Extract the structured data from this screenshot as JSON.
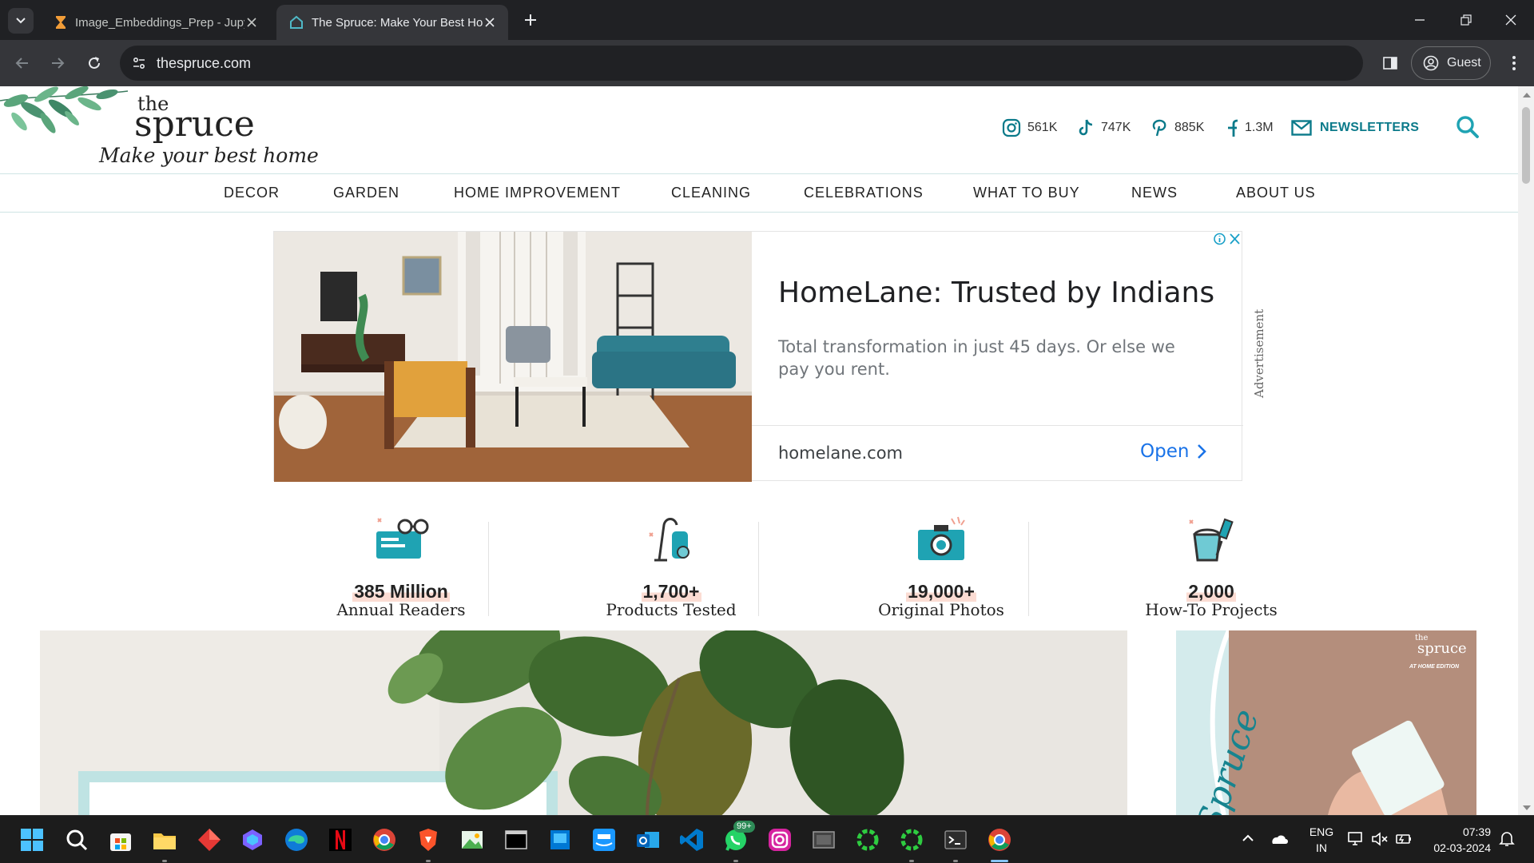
{
  "browser": {
    "tabs": [
      {
        "title": "Image_Embeddings_Prep - Jupy",
        "icon": "hourglass-icon",
        "active": false
      },
      {
        "title": "The Spruce: Make Your Best Ho",
        "icon": "spruce-favicon",
        "active": true
      }
    ],
    "url": "thespruce.com",
    "profile_label": "Guest"
  },
  "site": {
    "logo": {
      "the": "the",
      "name": "spruce",
      "tagline": "Make your best home"
    },
    "social": [
      {
        "icon": "instagram-icon",
        "count": "561K"
      },
      {
        "icon": "tiktok-icon",
        "count": "747K"
      },
      {
        "icon": "pinterest-icon",
        "count": "885K"
      },
      {
        "icon": "facebook-icon",
        "count": "1.3M"
      }
    ],
    "newsletters_label": "NEWSLETTERS",
    "accent_color": "#0b7a8a",
    "nav": [
      "DECOR",
      "GARDEN",
      "HOME IMPROVEMENT",
      "CLEANING",
      "CELEBRATIONS",
      "WHAT TO BUY",
      "NEWS",
      "ABOUT US"
    ]
  },
  "ad": {
    "title": "HomeLane: Trusted by Indians",
    "description": "Total transformation in just 45 days. Or else we pay you rent.",
    "domain": "homelane.com",
    "cta": "Open",
    "side_label": "Advertisement"
  },
  "stats": [
    {
      "value": "385 Million",
      "label": "Annual Readers",
      "icon": "glasses-laptop-icon"
    },
    {
      "value": "1,700+",
      "label": "Products Tested",
      "icon": "vacuum-icon"
    },
    {
      "value": "19,000+",
      "label": "Original Photos",
      "icon": "camera-icon"
    },
    {
      "value": "2,000",
      "label": "How-To Projects",
      "icon": "paint-bucket-icon"
    }
  ],
  "promo": {
    "brand_the": "the",
    "brand_name": "spruce",
    "edition": "AT HOME EDITION",
    "script": "Spruce"
  },
  "taskbar": {
    "apps": [
      "start-icon",
      "search-icon",
      "store-icon",
      "file-explorer-icon",
      "app-red-icon",
      "copilot-icon",
      "edge-icon",
      "netflix-icon",
      "chrome-icon",
      "brave-icon",
      "image-editor-icon",
      "terminal-icon",
      "windows-app-icon",
      "prime-video-icon",
      "outlook-icon",
      "vscode-icon",
      "whatsapp-icon",
      "instagram-icon",
      "media-icon",
      "spinner-app-icon",
      "spinner-app2-icon",
      "terminal2-icon",
      "chrome-active-icon"
    ],
    "whatsapp_badge": "99+",
    "language": "ENG",
    "region": "IN",
    "time": "07:39",
    "date": "02-03-2024"
  }
}
